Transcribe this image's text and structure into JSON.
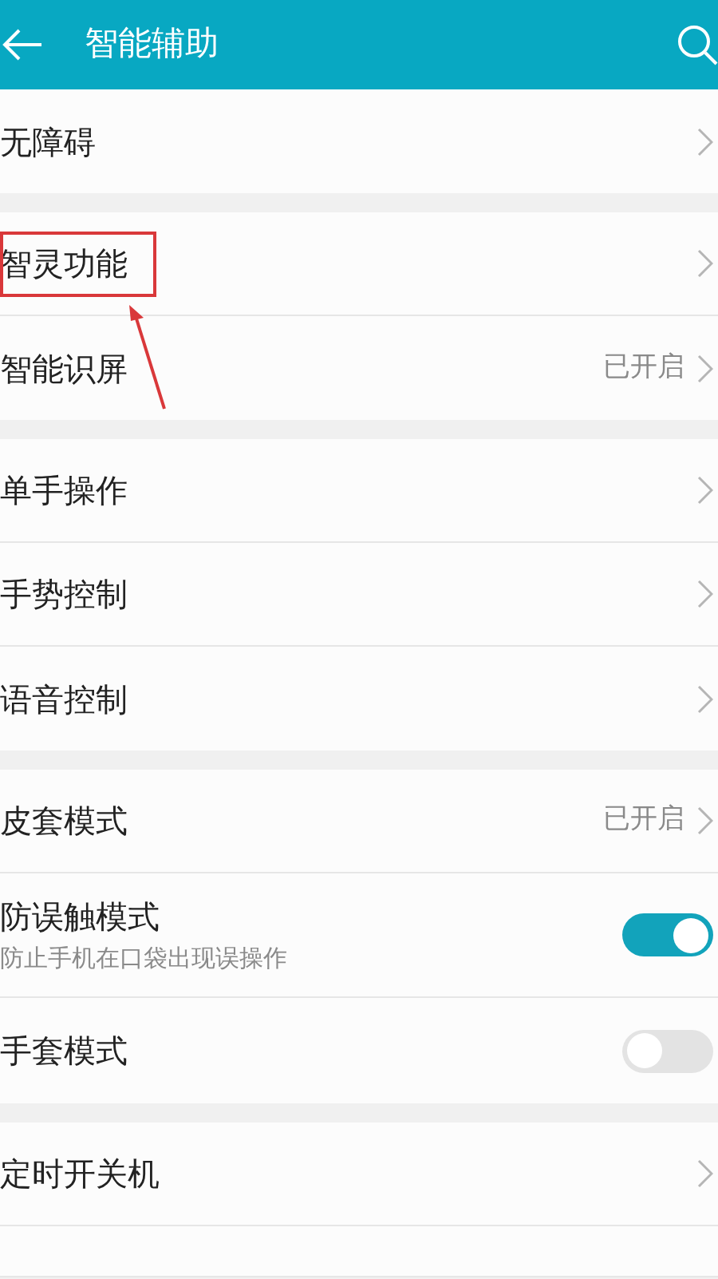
{
  "header": {
    "title": "智能辅助"
  },
  "groups": [
    {
      "rows": [
        {
          "kind": "link",
          "label": "无障碍"
        }
      ]
    },
    {
      "rows": [
        {
          "kind": "link",
          "label": "智灵功能",
          "highlighted": true
        },
        {
          "kind": "link",
          "label": "智能识屏",
          "value": "已开启"
        }
      ]
    },
    {
      "rows": [
        {
          "kind": "link",
          "label": "单手操作"
        },
        {
          "kind": "link",
          "label": "手势控制"
        },
        {
          "kind": "link",
          "label": "语音控制"
        }
      ]
    },
    {
      "rows": [
        {
          "kind": "link",
          "label": "皮套模式",
          "value": "已开启"
        },
        {
          "kind": "toggle",
          "label": "防误触模式",
          "subtitle": "防止手机在口袋出现误操作",
          "on": true
        },
        {
          "kind": "toggle",
          "label": "手套模式",
          "on": false
        }
      ]
    },
    {
      "rows": [
        {
          "kind": "link",
          "label": "定时开关机"
        },
        {
          "kind": "blank"
        }
      ]
    }
  ]
}
